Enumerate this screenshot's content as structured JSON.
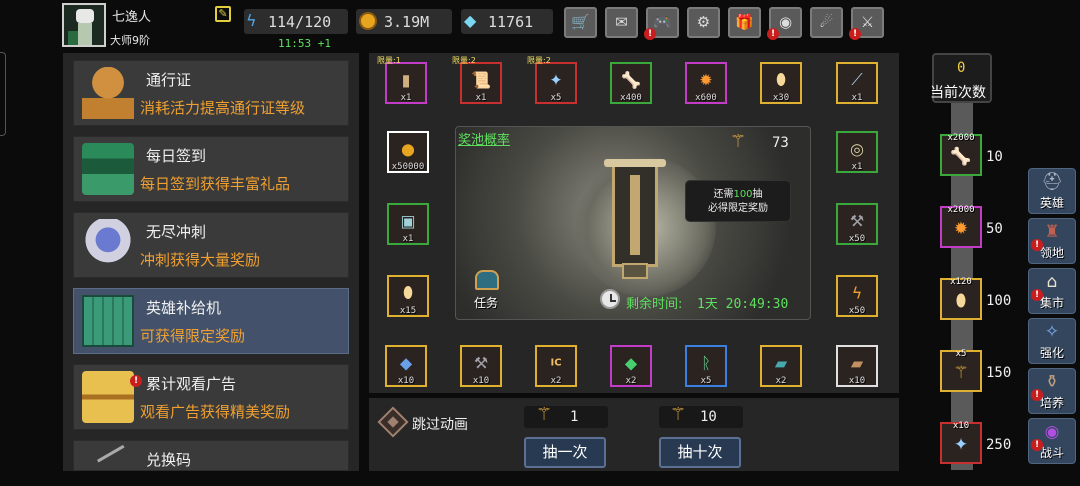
{
  "player": {
    "name": "七逸人",
    "rank": "大师9阶",
    "energy": "114/120",
    "energy_timer": "11:53 +1",
    "gold": "3.19M",
    "gems": "11761"
  },
  "topbar_icons": [
    "shop-cart-icon",
    "mail-icon",
    "gamepad-icon",
    "gear-icon",
    "gift-icon",
    "color-wheel-icon",
    "meteor-icon",
    "crossed-swords-icon"
  ],
  "menu": [
    {
      "title": "通行证",
      "desc": "消耗活力提高通行证等级",
      "icon": "goblet-icon"
    },
    {
      "title": "每日签到",
      "desc": "每日签到获得丰富礼品",
      "icon": "books-icon"
    },
    {
      "title": "无尽冲刺",
      "desc": "冲刺获得大量奖励",
      "icon": "armor-icon"
    },
    {
      "title": "英雄补给机",
      "desc": "可获得限定奖励",
      "icon": "machine-icon",
      "selected": true
    },
    {
      "title": "累计观看广告",
      "desc": "观看广告获得精美奖励",
      "icon": "treasure-chest-icon",
      "alert": true
    },
    {
      "title": "兑换码",
      "desc": "",
      "icon": "key-icon"
    }
  ],
  "pool": {
    "odds_label": "奖池概率",
    "draw_tokens": "73",
    "pity_text_pre": "还需",
    "pity_count": "100",
    "pity_text_mid": "抽",
    "pity_text_post": "必得限定奖励",
    "task_label": "任务",
    "remaining_label": "剩余时间:",
    "remaining_value": "1天 20:49:30"
  },
  "rewards_top": [
    {
      "limit": "限量:1",
      "qty": "x1",
      "icon": "banner-icon",
      "color": "#c23cc8"
    },
    {
      "limit": "限量:2",
      "qty": "x1",
      "icon": "scroll-icon",
      "color": "#c83030"
    },
    {
      "limit": "限量:2",
      "qty": "x5",
      "icon": "crystal-icon",
      "color": "#c83030"
    },
    {
      "limit": "",
      "qty": "x400",
      "icon": "bone-icon",
      "color": "#3aa83a"
    },
    {
      "limit": "",
      "qty": "x600",
      "icon": "fire-orb-icon",
      "color": "#c23cc8"
    },
    {
      "limit": "",
      "qty": "x30",
      "icon": "egg-icon",
      "color": "#e0b030"
    },
    {
      "limit": "",
      "qty": "x1",
      "icon": "feather-icon",
      "color": "#e0b030"
    }
  ],
  "rewards_left": [
    {
      "qty": "x50000",
      "icon": "gold-coin-icon",
      "color": "#ffffff"
    },
    {
      "qty": "x1",
      "icon": "chest-icon",
      "color": "#3aa83a"
    },
    {
      "qty": "x15",
      "icon": "egg-icon",
      "color": "#e0b030"
    }
  ],
  "rewards_right": [
    {
      "qty": "x1",
      "icon": "mirror-icon",
      "color": "#3aa83a"
    },
    {
      "qty": "x50",
      "icon": "hammer-icon",
      "color": "#3aa83a"
    },
    {
      "qty": "x50",
      "icon": "lightning-icon",
      "color": "#e0b030"
    }
  ],
  "rewards_bottom": [
    {
      "qty": "x10",
      "icon": "ore-icon",
      "color": "#e0b030"
    },
    {
      "qty": "x10",
      "icon": "hammer-icon",
      "color": "#e0b030"
    },
    {
      "qty": "x2",
      "icon": "ic-chip-icon",
      "color": "#e0b030"
    },
    {
      "qty": "x2",
      "icon": "green-gem-icon",
      "color": "#c23cc8"
    },
    {
      "qty": "x5",
      "icon": "rune-icon",
      "color": "#3a80e0"
    },
    {
      "qty": "x2",
      "icon": "tome-icon",
      "color": "#e0b030"
    },
    {
      "qty": "x10",
      "icon": "book-icon",
      "color": "#e0e0e0"
    }
  ],
  "controls": {
    "skip_label": "跳过动画",
    "single_cost": "1",
    "ten_cost": "10",
    "single_btn": "抽一次",
    "ten_btn": "抽十次"
  },
  "milestones": {
    "count": "0",
    "label": "当前次数",
    "items": [
      {
        "qty": "x2000",
        "threshold": "10",
        "icon": "bone-icon",
        "color": "#3aa83a"
      },
      {
        "qty": "x2000",
        "threshold": "50",
        "icon": "fire-orb-icon",
        "color": "#c23cc8"
      },
      {
        "qty": "x120",
        "threshold": "100",
        "icon": "egg-icon",
        "color": "#e0b030"
      },
      {
        "qty": "x5",
        "threshold": "150",
        "icon": "wand-icon",
        "color": "#e0b030"
      },
      {
        "qty": "x10",
        "threshold": "250",
        "icon": "crystal-icon",
        "color": "#c83030"
      }
    ]
  },
  "side_nav": [
    {
      "label": "英雄",
      "icon": "helmet-icon",
      "alert": false
    },
    {
      "label": "领地",
      "icon": "castle-icon",
      "alert": true
    },
    {
      "label": "集市",
      "icon": "market-icon",
      "alert": true
    },
    {
      "label": "强化",
      "icon": "upgrade-icon",
      "alert": false
    },
    {
      "label": "培养",
      "icon": "cultivate-icon",
      "alert": true
    },
    {
      "label": "战斗",
      "icon": "portal-icon",
      "alert": true
    }
  ]
}
